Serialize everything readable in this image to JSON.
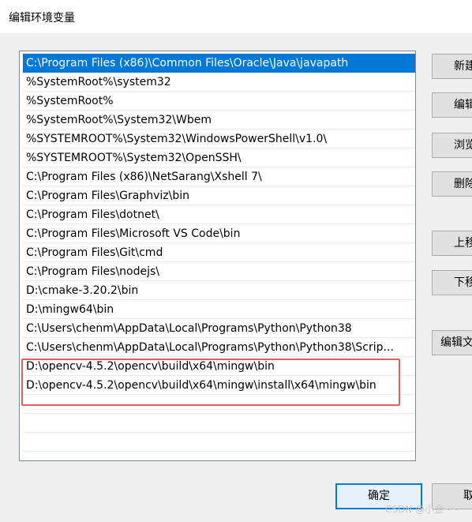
{
  "window": {
    "title": "编辑环境变量"
  },
  "path_list": {
    "items": [
      "C:\\Program Files (x86)\\Common Files\\Oracle\\Java\\javapath",
      "%SystemRoot%\\system32",
      "%SystemRoot%",
      "%SystemRoot%\\System32\\Wbem",
      "%SYSTEMROOT%\\System32\\WindowsPowerShell\\v1.0\\",
      "%SYSTEMROOT%\\System32\\OpenSSH\\",
      "C:\\Program Files (x86)\\NetSarang\\Xshell 7\\",
      "C:\\Program Files\\Graphviz\\bin",
      "C:\\Program Files\\dotnet\\",
      "C:\\Program Files\\Microsoft VS Code\\bin",
      "C:\\Program Files\\Git\\cmd",
      "C:\\Program Files\\nodejs\\",
      "D:\\cmake-3.20.2\\bin",
      "D:\\mingw64\\bin",
      "C:\\Users\\chenm\\AppData\\Local\\Programs\\Python\\Python38",
      "C:\\Users\\chenm\\AppData\\Local\\Programs\\Python\\Python38\\Scrip...",
      "D:\\opencv-4.5.2\\opencv\\build\\x64\\mingw\\bin",
      "D:\\opencv-4.5.2\\opencv\\build\\x64\\mingw\\install\\x64\\mingw\\bin"
    ],
    "selected_index": 0
  },
  "side_buttons": {
    "new_label": "新建(N)",
    "edit_label": "编辑(E)",
    "browse_label": "浏览(B)...",
    "delete_label": "删除(D)",
    "move_up_label": "上移(U)",
    "move_down_label": "下移(O)",
    "edit_text_label": "编辑文本(T)..."
  },
  "footer": {
    "ok_label": "确定",
    "cancel_label": "取消"
  },
  "watermark": "CSDN @小金~~",
  "colors": {
    "selection": "#0078d7",
    "highlight_box": "#e0605f"
  }
}
